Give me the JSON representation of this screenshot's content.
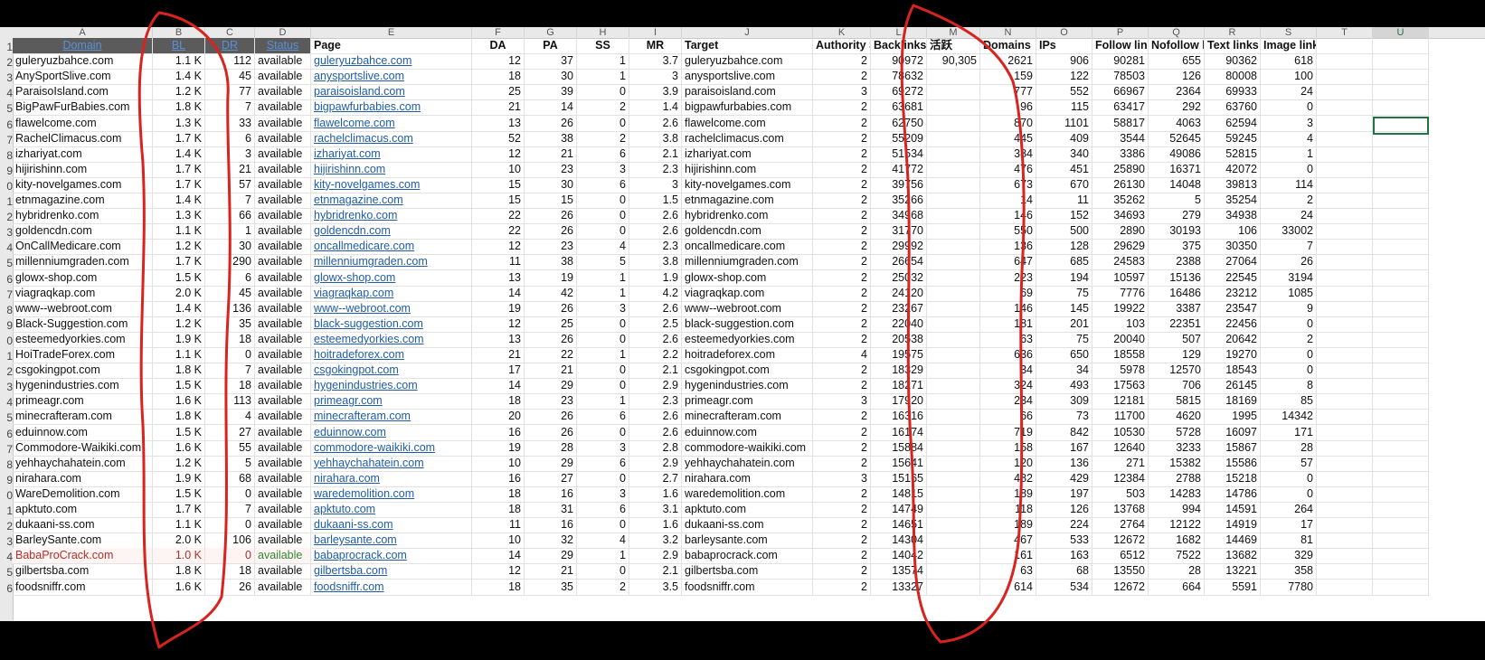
{
  "columns": [
    "A",
    "B",
    "C",
    "D",
    "E",
    "F",
    "G",
    "H",
    "I",
    "J",
    "K",
    "L",
    "M",
    "N",
    "O",
    "P",
    "Q",
    "R",
    "S",
    "T",
    "U"
  ],
  "row_numbers": [
    "1",
    "2",
    "3",
    "4",
    "5",
    "6",
    "7",
    "8",
    "9",
    "0",
    "1",
    "2",
    "3",
    "4",
    "5",
    "6",
    "7",
    "8",
    "9",
    "0",
    "1",
    "2",
    "3",
    "4",
    "5",
    "6",
    "7",
    "8",
    "9",
    "0",
    "1",
    "2",
    "3",
    "4",
    "5",
    "6"
  ],
  "headers": [
    "Domain",
    "BL",
    "DR",
    "Status",
    "Page",
    "DA",
    "PA",
    "SS",
    "MR",
    "Target",
    "Authority Sc",
    "Backlinks",
    "活跃",
    "Domains",
    "IPs",
    "Follow links",
    "Nofollow link",
    "Text links",
    "Image links",
    "",
    ""
  ],
  "rows": [
    [
      "guleryuzbahce.com",
      "1.1 K",
      "112",
      "available",
      "guleryuzbahce.com",
      "12",
      "37",
      "1",
      "3.7",
      "guleryuzbahce.com",
      "2",
      "90972",
      "90,305",
      "2621",
      "906",
      "90281",
      "655",
      "90362",
      "618"
    ],
    [
      "AnySportSlive.com",
      "1.4 K",
      "45",
      "available",
      "anysportslive.com",
      "18",
      "30",
      "1",
      "3",
      "anysportslive.com",
      "2",
      "78632",
      "",
      "159",
      "122",
      "78503",
      "126",
      "80008",
      "100"
    ],
    [
      "ParaisoIsland.com",
      "1.2 K",
      "77",
      "available",
      "paraisoisland.com",
      "25",
      "39",
      "0",
      "3.9",
      "paraisoisland.com",
      "3",
      "69272",
      "",
      "777",
      "552",
      "66967",
      "2364",
      "69933",
      "24"
    ],
    [
      "BigPawFurBabies.com",
      "1.8 K",
      "7",
      "available",
      "bigpawfurbabies.com",
      "21",
      "14",
      "2",
      "1.4",
      "bigpawfurbabies.com",
      "2",
      "63681",
      "",
      "96",
      "115",
      "63417",
      "292",
      "63760",
      "0"
    ],
    [
      "flawelcome.com",
      "1.3 K",
      "33",
      "available",
      "flawelcome.com",
      "13",
      "26",
      "0",
      "2.6",
      "flawelcome.com",
      "2",
      "62750",
      "",
      "870",
      "1101",
      "58817",
      "4063",
      "62594",
      "3"
    ],
    [
      "RachelClimacus.com",
      "1.7 K",
      "6",
      "available",
      "rachelclimacus.com",
      "52",
      "38",
      "2",
      "3.8",
      "rachelclimacus.com",
      "2",
      "55209",
      "",
      "445",
      "409",
      "3544",
      "52645",
      "59245",
      "4"
    ],
    [
      "izhariyat.com",
      "1.4 K",
      "3",
      "available",
      "izhariyat.com",
      "12",
      "21",
      "6",
      "2.1",
      "izhariyat.com",
      "2",
      "51534",
      "",
      "384",
      "340",
      "3386",
      "49086",
      "52815",
      "1"
    ],
    [
      "hijirishinn.com",
      "1.7 K",
      "21",
      "available",
      "hijirishinn.com",
      "10",
      "23",
      "3",
      "2.3",
      "hijirishinn.com",
      "2",
      "41772",
      "",
      "476",
      "451",
      "25890",
      "16371",
      "42072",
      "0"
    ],
    [
      "kity-novelgames.com",
      "1.7 K",
      "57",
      "available",
      "kity-novelgames.com",
      "15",
      "30",
      "6",
      "3",
      "kity-novelgames.com",
      "2",
      "39756",
      "",
      "673",
      "670",
      "26130",
      "14048",
      "39813",
      "114"
    ],
    [
      "etnmagazine.com",
      "1.4 K",
      "7",
      "available",
      "etnmagazine.com",
      "15",
      "15",
      "0",
      "1.5",
      "etnmagazine.com",
      "2",
      "35266",
      "",
      "14",
      "11",
      "35262",
      "5",
      "35254",
      "2"
    ],
    [
      "hybridrenko.com",
      "1.3 K",
      "66",
      "available",
      "hybridrenko.com",
      "22",
      "26",
      "0",
      "2.6",
      "hybridrenko.com",
      "2",
      "34968",
      "",
      "146",
      "152",
      "34693",
      "279",
      "34938",
      "24"
    ],
    [
      "goldencdn.com",
      "1.1 K",
      "1",
      "available",
      "goldencdn.com",
      "22",
      "26",
      "0",
      "2.6",
      "goldencdn.com",
      "2",
      "31770",
      "",
      "550",
      "500",
      "2890",
      "30193",
      "106",
      "33002"
    ],
    [
      "OnCallMedicare.com",
      "1.2 K",
      "30",
      "available",
      "oncallmedicare.com",
      "12",
      "23",
      "4",
      "2.3",
      "oncallmedicare.com",
      "2",
      "29992",
      "",
      "136",
      "128",
      "29629",
      "375",
      "30350",
      "7"
    ],
    [
      "millenniumgraden.com",
      "1.7 K",
      "290",
      "available",
      "millenniumgraden.com",
      "11",
      "38",
      "5",
      "3.8",
      "millenniumgraden.com",
      "2",
      "26654",
      "",
      "647",
      "685",
      "24583",
      "2388",
      "27064",
      "26"
    ],
    [
      "glowx-shop.com",
      "1.5 K",
      "6",
      "available",
      "glowx-shop.com",
      "13",
      "19",
      "1",
      "1.9",
      "glowx-shop.com",
      "2",
      "25032",
      "",
      "223",
      "194",
      "10597",
      "15136",
      "22545",
      "3194"
    ],
    [
      "viagraqkap.com",
      "2.0 K",
      "45",
      "available",
      "viagraqkap.com",
      "14",
      "42",
      "1",
      "4.2",
      "viagraqkap.com",
      "2",
      "24120",
      "",
      "69",
      "75",
      "7776",
      "16486",
      "23212",
      "1085"
    ],
    [
      "www--webroot.com",
      "1.4 K",
      "136",
      "available",
      "www--webroot.com",
      "19",
      "26",
      "3",
      "2.6",
      "www--webroot.com",
      "2",
      "23267",
      "",
      "146",
      "145",
      "19922",
      "3387",
      "23547",
      "9"
    ],
    [
      "Black-Suggestion.com",
      "1.2 K",
      "35",
      "available",
      "black-suggestion.com",
      "12",
      "25",
      "0",
      "2.5",
      "black-suggestion.com",
      "2",
      "22040",
      "",
      "181",
      "201",
      "103",
      "22351",
      "22456",
      "0"
    ],
    [
      "esteemedyorkies.com",
      "1.9 K",
      "18",
      "available",
      "esteemedyorkies.com",
      "13",
      "26",
      "0",
      "2.6",
      "esteemedyorkies.com",
      "2",
      "20538",
      "",
      "63",
      "75",
      "20040",
      "507",
      "20642",
      "2"
    ],
    [
      "HoiTradeForex.com",
      "1.1 K",
      "0",
      "available",
      "hoitradeforex.com",
      "21",
      "22",
      "1",
      "2.2",
      "hoitradeforex.com",
      "4",
      "19575",
      "",
      "636",
      "650",
      "18558",
      "129",
      "19270",
      "0"
    ],
    [
      "csgokingpot.com",
      "1.8 K",
      "7",
      "available",
      "csgokingpot.com",
      "17",
      "21",
      "0",
      "2.1",
      "csgokingpot.com",
      "2",
      "18329",
      "",
      "34",
      "34",
      "5978",
      "12570",
      "18543",
      "0"
    ],
    [
      "hygenindustries.com",
      "1.5 K",
      "18",
      "available",
      "hygenindustries.com",
      "14",
      "29",
      "0",
      "2.9",
      "hygenindustries.com",
      "2",
      "18271",
      "",
      "324",
      "493",
      "17563",
      "706",
      "26145",
      "8"
    ],
    [
      "primeagr.com",
      "1.6 K",
      "113",
      "available",
      "primeagr.com",
      "18",
      "23",
      "1",
      "2.3",
      "primeagr.com",
      "3",
      "17920",
      "",
      "234",
      "309",
      "12181",
      "5815",
      "18169",
      "85"
    ],
    [
      "minecrafteram.com",
      "1.8 K",
      "4",
      "available",
      "minecrafteram.com",
      "20",
      "26",
      "6",
      "2.6",
      "minecrafteram.com",
      "2",
      "16316",
      "",
      "66",
      "73",
      "11700",
      "4620",
      "1995",
      "14342"
    ],
    [
      "eduinnow.com",
      "1.5 K",
      "27",
      "available",
      "eduinnow.com",
      "16",
      "26",
      "0",
      "2.6",
      "eduinnow.com",
      "2",
      "16174",
      "",
      "719",
      "842",
      "10530",
      "5728",
      "16097",
      "171"
    ],
    [
      "Commodore-Waikiki.com",
      "1.6 K",
      "55",
      "available",
      "commodore-waikiki.com",
      "19",
      "28",
      "3",
      "2.8",
      "commodore-waikiki.com",
      "2",
      "15884",
      "",
      "158",
      "167",
      "12640",
      "3233",
      "15867",
      "28"
    ],
    [
      "yehhaychahatein.com",
      "1.2 K",
      "5",
      "available",
      "yehhaychahatein.com",
      "10",
      "29",
      "6",
      "2.9",
      "yehhaychahatein.com",
      "2",
      "15641",
      "",
      "120",
      "136",
      "271",
      "15382",
      "15586",
      "57"
    ],
    [
      "nirahara.com",
      "1.9 K",
      "68",
      "available",
      "nirahara.com",
      "16",
      "27",
      "0",
      "2.7",
      "nirahara.com",
      "3",
      "15165",
      "",
      "482",
      "429",
      "12384",
      "2788",
      "15218",
      "0"
    ],
    [
      "WareDemolition.com",
      "1.5 K",
      "0",
      "available",
      "waredemolition.com",
      "18",
      "16",
      "3",
      "1.6",
      "waredemolition.com",
      "2",
      "14815",
      "",
      "189",
      "197",
      "503",
      "14283",
      "14786",
      "0"
    ],
    [
      "apktuto.com",
      "1.7 K",
      "7",
      "available",
      "apktuto.com",
      "18",
      "31",
      "6",
      "3.1",
      "apktuto.com",
      "2",
      "14749",
      "",
      "118",
      "126",
      "13768",
      "994",
      "14591",
      "264"
    ],
    [
      "dukaani-ss.com",
      "1.1 K",
      "0",
      "available",
      "dukaani-ss.com",
      "11",
      "16",
      "0",
      "1.6",
      "dukaani-ss.com",
      "2",
      "14651",
      "",
      "189",
      "224",
      "2764",
      "12122",
      "14919",
      "17"
    ],
    [
      "BarleySante.com",
      "2.0 K",
      "106",
      "available",
      "barleysante.com",
      "10",
      "32",
      "4",
      "3.2",
      "barleysante.com",
      "2",
      "14304",
      "",
      "467",
      "533",
      "12672",
      "1682",
      "14469",
      "81"
    ],
    [
      "BabaProCrack.com",
      "1.0 K",
      "0",
      "available",
      "babaprocrack.com",
      "14",
      "29",
      "1",
      "2.9",
      "babaprocrack.com",
      "2",
      "14042",
      "",
      "161",
      "163",
      "6512",
      "7522",
      "13682",
      "329"
    ],
    [
      "gilbertsba.com",
      "1.8 K",
      "18",
      "available",
      "gilbertsba.com",
      "12",
      "21",
      "0",
      "2.1",
      "gilbertsba.com",
      "2",
      "13574",
      "",
      "63",
      "68",
      "13550",
      "28",
      "13221",
      "358"
    ],
    [
      "foodsniffr.com",
      "1.6 K",
      "26",
      "available",
      "foodsniffr.com",
      "18",
      "35",
      "2",
      "3.5",
      "foodsniffr.com",
      "2",
      "13327",
      "",
      "614",
      "534",
      "12672",
      "664",
      "5591",
      "7780"
    ]
  ],
  "colors": {
    "annotation": "#d8231f",
    "link": "#1f5ca8",
    "selection": "#217346"
  }
}
